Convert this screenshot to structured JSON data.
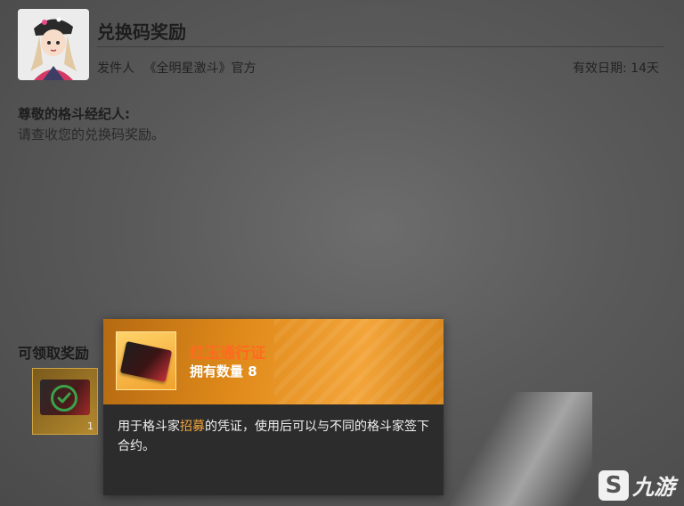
{
  "mail": {
    "title": "兑换码奖励",
    "sender_label": "发件人",
    "sender_name": "《全明星激斗》官方",
    "validity_label": "有效日期:",
    "validity_value": "14天",
    "greeting": "尊敬的格斗经纪人:",
    "message": "请查收您的兑换码奖励。",
    "rewards_label": "可领取奖励",
    "reward_slot": {
      "count": "1",
      "claimed": true
    }
  },
  "tooltip": {
    "item_name": "红玉通行证",
    "quantity_label": "拥有数量",
    "quantity_value": "8",
    "description_part1": "用于格斗家",
    "description_highlight": "招募",
    "description_part2": "的凭证，使用后可以与不同的格斗家签下合约。"
  },
  "watermark": {
    "glyph": "S",
    "text": "九游"
  },
  "colors": {
    "accent_orange": "#f3a53a",
    "item_name_color": "#ff6a20",
    "check_green": "#3aa34a"
  },
  "icons": {
    "avatar": "character-portrait",
    "reward_item": "red-jade-pass-card",
    "claimed": "check-circle-icon"
  }
}
